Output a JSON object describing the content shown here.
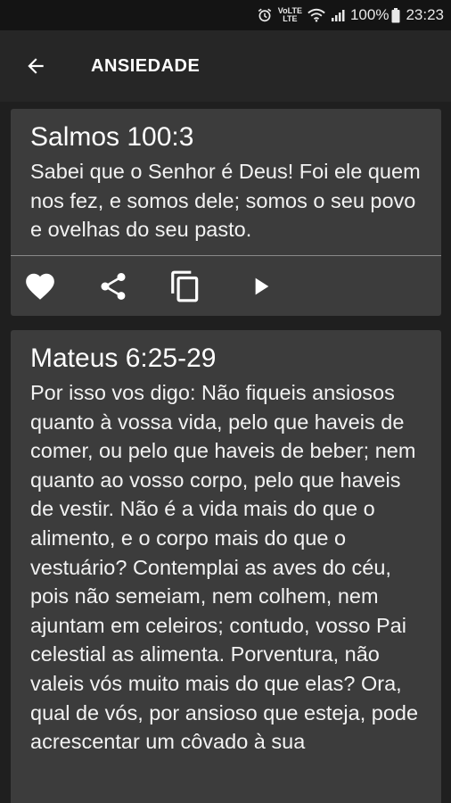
{
  "status_bar": {
    "volte_top": "VoLTE",
    "volte_bottom": "LTE",
    "battery": "100%",
    "time": "23:23",
    "icons": [
      "alarm-icon",
      "wifi-icon",
      "signal-icon",
      "battery-icon"
    ]
  },
  "app_bar": {
    "title": "ANSIEDADE",
    "back_icon": "arrow-left-icon"
  },
  "cards": [
    {
      "reference": "Salmos 100:3",
      "text": "Sabei que o Senhor é Deus! Foi ele quem nos fez, e somos dele; somos o seu povo e ovelhas do seu pasto.",
      "actions": [
        "heart-icon",
        "share-icon",
        "copy-icon",
        "play-icon"
      ]
    },
    {
      "reference": "Mateus 6:25-29",
      "text": "Por isso vos digo: Não fiqueis ansiosos quanto à vossa vida, pelo que haveis de comer, ou pelo que haveis de beber; nem quanto ao vosso corpo, pelo que haveis de vestir. Não é a vida mais do que o alimento, e o corpo mais do que o vestuário? Contemplai as aves do céu, pois não semeiam, nem colhem, nem ajuntam em celeiros; contudo, vosso Pai celestial as alimenta. Porventura, não valeis vós muito mais do que elas? Ora, qual de vós, por ansioso que esteja, pode acrescentar um côvado à sua"
    }
  ],
  "colors": {
    "background": "#1f1f1f",
    "app_bar": "#262626",
    "card": "#3c3c3c",
    "text": "#ffffff"
  }
}
